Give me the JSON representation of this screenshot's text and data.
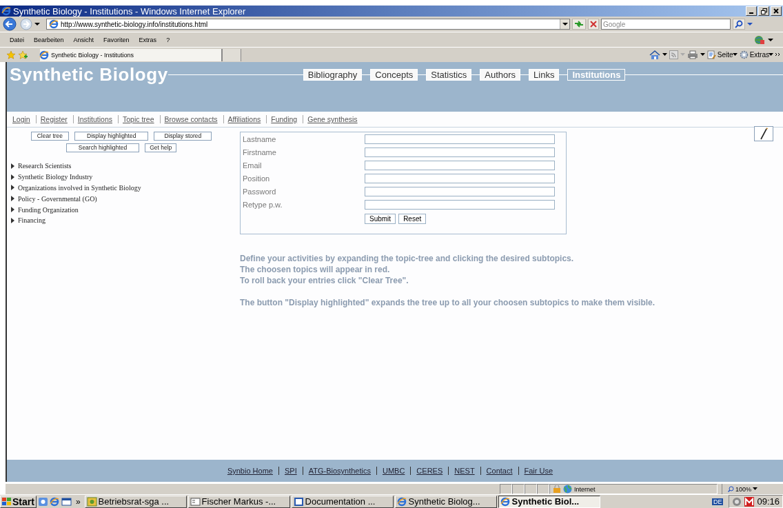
{
  "window": {
    "title": "Synthetic Biology - Institutions - Windows Internet Explorer"
  },
  "address_bar": {
    "url": "http://www.synthetic-biology.info/institutions.html",
    "search_placeholder": "Google"
  },
  "menu": [
    "Datei",
    "Bearbeiten",
    "Ansicht",
    "Favoriten",
    "Extras",
    "?"
  ],
  "favorites_bar": {
    "tab": "Synthetic Biology - Institutions"
  },
  "command_bar": [
    "Seite",
    "Extras"
  ],
  "site": {
    "brand": "Synthetic Biology",
    "main_nav": [
      {
        "label": "Bibliography",
        "selected": false
      },
      {
        "label": "Concepts",
        "selected": false
      },
      {
        "label": "Statistics",
        "selected": false
      },
      {
        "label": "Authors",
        "selected": false
      },
      {
        "label": "Links",
        "selected": false
      },
      {
        "label": "Institutions",
        "selected": true
      }
    ],
    "sub_nav": [
      "Login",
      "Register",
      "Institutions",
      "Topic tree",
      "Browse contacts",
      "Affiliations",
      "Funding",
      "Gene synthesis"
    ],
    "tree_buttons": [
      [
        "Clear tree",
        "Display highlighted",
        "Display stored"
      ],
      [
        "Search highlighted",
        "Get help"
      ]
    ],
    "tree": [
      {
        "label": "Research Scientists",
        "expanded": false
      },
      {
        "label": "Synthetic Biology Industry",
        "expanded": false
      },
      {
        "label": "Organizations involved in Synthetic Biology",
        "expanded": false
      },
      {
        "label": "Policy - Governmental (GO)",
        "expanded": false
      },
      {
        "label": "Funding Organization",
        "expanded": false
      },
      {
        "label": "Financing",
        "expanded": false
      }
    ],
    "form": {
      "fields": [
        "Lastname",
        "Firstname",
        "Email",
        "Position",
        "Password",
        "Retype p.w."
      ],
      "buttons": [
        "Submit",
        "Reset"
      ]
    },
    "help": [
      [
        "Define your activities by expanding the topic-tree and clicking the desired subtopics.",
        "The choosen topics will appear in red.",
        "To roll back your entries click \"Clear Tree\"."
      ],
      [
        "The button \"Display highlighted\" expands the tree up to all your choosen subtopics to make them visible."
      ]
    ],
    "footer": [
      "Synbio Home",
      "SPI",
      "ATG-Biosynthetics",
      "UMBC",
      "CERES",
      "NEST",
      "Contact",
      "Fair Use"
    ]
  },
  "status_bar": {
    "zone": "Internet",
    "zoom": "100%"
  },
  "taskbar": {
    "start": "Start",
    "more": "»",
    "tasks": [
      {
        "label": "Betriebsrat-sga ...",
        "selected": false
      },
      {
        "label": "Fischer Markus -...",
        "selected": false
      },
      {
        "label": "Documentation ...",
        "selected": false
      },
      {
        "label": "Synthetic Biolog...",
        "selected": false
      },
      {
        "label": "Synthetic Biol...",
        "selected": true
      }
    ],
    "language": "DE",
    "clock": "09:16"
  }
}
